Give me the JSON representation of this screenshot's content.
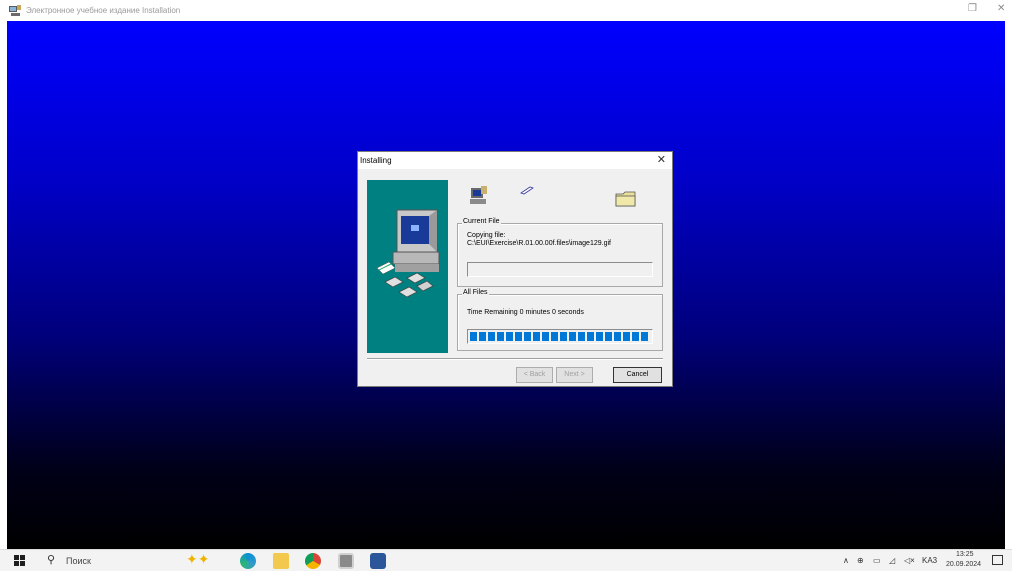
{
  "app": {
    "title": "Электронное учебное издание Installation",
    "restore_glyph": "❐",
    "close_glyph": "✕"
  },
  "dialog": {
    "title": "Installing",
    "close_glyph": "✕",
    "current_file": {
      "group_label": "Current File",
      "copy_label": "Copying file:",
      "path": "C:\\EUI\\Exercise\\R.01.00.00f.files\\image129.gif",
      "progress": 0
    },
    "all_files": {
      "group_label": "All Files",
      "time_remaining": "Time Remaining 0 minutes 0 seconds",
      "progress": 1.0
    },
    "buttons": {
      "back": "< Back",
      "next": "Next >",
      "cancel": "Cancel"
    },
    "icons": [
      "setup-computer-icon",
      "flying-document-icon",
      "folder-icon",
      "computer-with-disks-icon"
    ]
  },
  "taskbar": {
    "search_placeholder": "Поиск",
    "apps": [
      "edge-icon",
      "file-explorer-icon",
      "chrome-icon",
      "installer-icon",
      "word-icon"
    ],
    "tray": {
      "chevron": "∧",
      "language": "KA3",
      "time": "13:25",
      "date": "20.09.2024"
    }
  },
  "colors": {
    "installer_bg_top": "#0000ff",
    "installer_bg_bottom": "#000000",
    "side_panel": "#008080",
    "progress_fill": "#0078d7"
  }
}
